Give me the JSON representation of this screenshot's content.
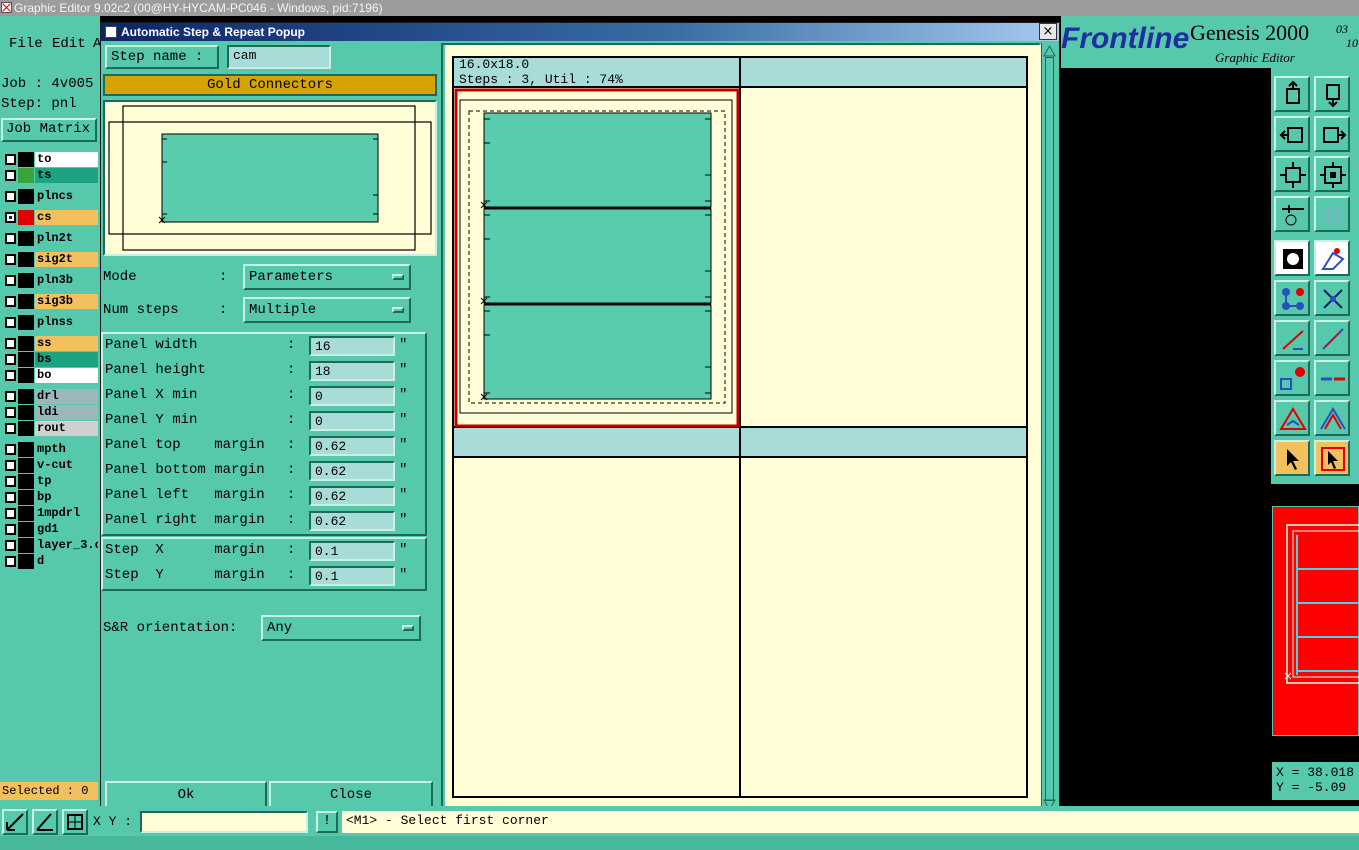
{
  "window": {
    "title": "Graphic Editor 9.02c2 (00@HY-HYCAM-PC046 - Windows, pid:7196)"
  },
  "menu": {
    "file": "File",
    "edit": "Edit",
    "more": "A"
  },
  "job": {
    "job_line": "Job : 4v005",
    "step_line": "Step: pnl",
    "matrix_button": "Job Matrix"
  },
  "layers": [
    {
      "name": "to",
      "color": "#ffffff",
      "swatch": "#000000",
      "checked": false
    },
    {
      "name": "ts",
      "color": "#1ba382",
      "swatch": "#3aa33a",
      "checked": false
    },
    {
      "name": "plncs",
      "color": "#56c8ac",
      "swatch": "#000000",
      "checked": false
    },
    {
      "name": "cs",
      "color": "#f3c05e",
      "swatch": "#e00000",
      "checked": true
    },
    {
      "name": "pln2t",
      "color": "#56c8ac",
      "swatch": "#000000",
      "checked": false
    },
    {
      "name": "sig2t",
      "color": "#f3c05e",
      "swatch": "#000000",
      "checked": false
    },
    {
      "name": "pln3b",
      "color": "#56c8ac",
      "swatch": "#000000",
      "checked": false
    },
    {
      "name": "sig3b",
      "color": "#f3c05e",
      "swatch": "#000000",
      "checked": false
    },
    {
      "name": "plnss",
      "color": "#56c8ac",
      "swatch": "#000000",
      "checked": false
    },
    {
      "name": "ss",
      "color": "#f3c05e",
      "swatch": "#000000",
      "checked": false
    },
    {
      "name": "bs",
      "color": "#1ba382",
      "swatch": "#000000",
      "checked": false
    },
    {
      "name": "bo",
      "color": "#ffffff",
      "swatch": "#000000",
      "checked": false
    },
    {
      "name": "drl",
      "color": "#9ab8bc",
      "swatch": "#000000",
      "checked": false
    },
    {
      "name": "ldi",
      "color": "#9ab8bc",
      "swatch": "#000000",
      "checked": false
    },
    {
      "name": "rout",
      "color": "#d0d0d0",
      "swatch": "#000000",
      "checked": false
    },
    {
      "name": "mpth",
      "color": "#56c8ac",
      "swatch": "#000000",
      "checked": false
    },
    {
      "name": "v-cut",
      "color": "#56c8ac",
      "swatch": "#000000",
      "checked": false
    },
    {
      "name": "tp",
      "color": "#56c8ac",
      "swatch": "#000000",
      "checked": false
    },
    {
      "name": "bp",
      "color": "#56c8ac",
      "swatch": "#000000",
      "checked": false
    },
    {
      "name": "1mpdrl",
      "color": "#56c8ac",
      "swatch": "#000000",
      "checked": false
    },
    {
      "name": "gd1",
      "color": "#56c8ac",
      "swatch": "#000000",
      "checked": false
    },
    {
      "name": "layer_3.c",
      "color": "#56c8ac",
      "swatch": "#000000",
      "checked": false
    },
    {
      "name": "d",
      "color": "#56c8ac",
      "swatch": "#000000",
      "checked": false
    }
  ],
  "selected": "Selected : 0",
  "popup": {
    "title": "Automatic Step & Repeat Popup",
    "close_x": "×",
    "step_name_label": "Step name :",
    "step_name_value": "cam",
    "profile_label": "Gold Connectors",
    "mode_label": "Mode",
    "mode_colon": ":",
    "mode_value": "Parameters",
    "num_steps_label": "Num steps",
    "num_steps_colon": ":",
    "num_steps_value": "Multiple",
    "params_group1": [
      {
        "label": "Panel width",
        "value": "16",
        "unit": "\""
      },
      {
        "label": "Panel height",
        "value": "18",
        "unit": "\""
      },
      {
        "label": "Panel X min",
        "value": "0",
        "unit": "\""
      },
      {
        "label": "Panel Y min",
        "value": "0",
        "unit": "\""
      },
      {
        "label": "Panel top    margin",
        "value": "0.62",
        "unit": "\""
      },
      {
        "label": "Panel bottom margin",
        "value": "0.62",
        "unit": "\""
      },
      {
        "label": "Panel left   margin",
        "value": "0.62",
        "unit": "\""
      },
      {
        "label": "Panel right  margin",
        "value": "0.62",
        "unit": "\""
      }
    ],
    "params_group2": [
      {
        "label": "Step  X      margin",
        "value": "0.1",
        "unit": "\""
      },
      {
        "label": "Step  Y      margin",
        "value": "0.1",
        "unit": "\""
      }
    ],
    "colon": ":",
    "orientation_label": "S&R orientation:",
    "orientation_value": "Any",
    "ok_label": "Ok",
    "close_label": "Close",
    "result_size": "16.0x18.0",
    "result_steps": "Steps : 3, Util : 74%"
  },
  "branding": {
    "frontline": "Frontline",
    "genesis": "Genesis 2000",
    "version_sup": "03",
    "version_sub": "10",
    "graphic_editor": "Graphic Editor"
  },
  "coords": {
    "x": "X = 38.018",
    "y": "Y = -5.09"
  },
  "bottom": {
    "xy_label": "X Y :",
    "bang": "!",
    "status": "<M1> - Select first corner"
  },
  "colors": {
    "panel_bg": "#56c8ac",
    "canvas_bg": "#fffed6",
    "gold": "#d6a400",
    "selection_red": "#c00000",
    "pcb_green": "#58ccac"
  }
}
